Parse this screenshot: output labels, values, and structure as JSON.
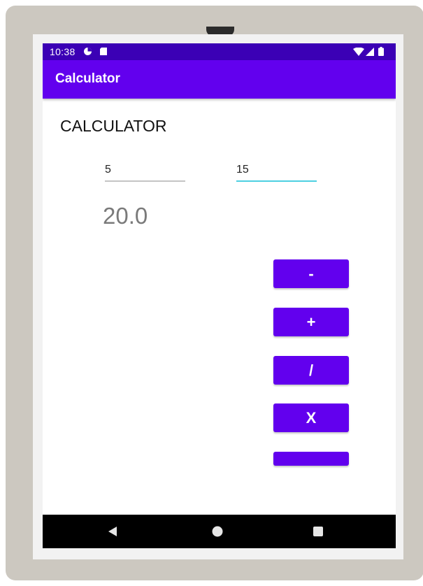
{
  "status_bar": {
    "time": "10:38",
    "icons": [
      "app-notification-icon",
      "sd-card-icon",
      "wifi-icon",
      "signal-icon",
      "battery-icon"
    ]
  },
  "app_bar": {
    "title": "Calculator"
  },
  "main": {
    "heading": "CALCULATOR",
    "first_number": "5",
    "second_number": "15",
    "result": "20.0"
  },
  "buttons": [
    {
      "label": "-"
    },
    {
      "label": "+"
    },
    {
      "label": "/"
    },
    {
      "label": "X"
    },
    {
      "label": ""
    }
  ],
  "nav": {
    "icons": [
      "back-icon",
      "home-icon",
      "recents-icon"
    ]
  },
  "colors": {
    "accent": "#6200EE",
    "status_bar": "#3B00B5",
    "focus_line": "#4DD0E1",
    "device_frame": "#CCC8C0"
  }
}
